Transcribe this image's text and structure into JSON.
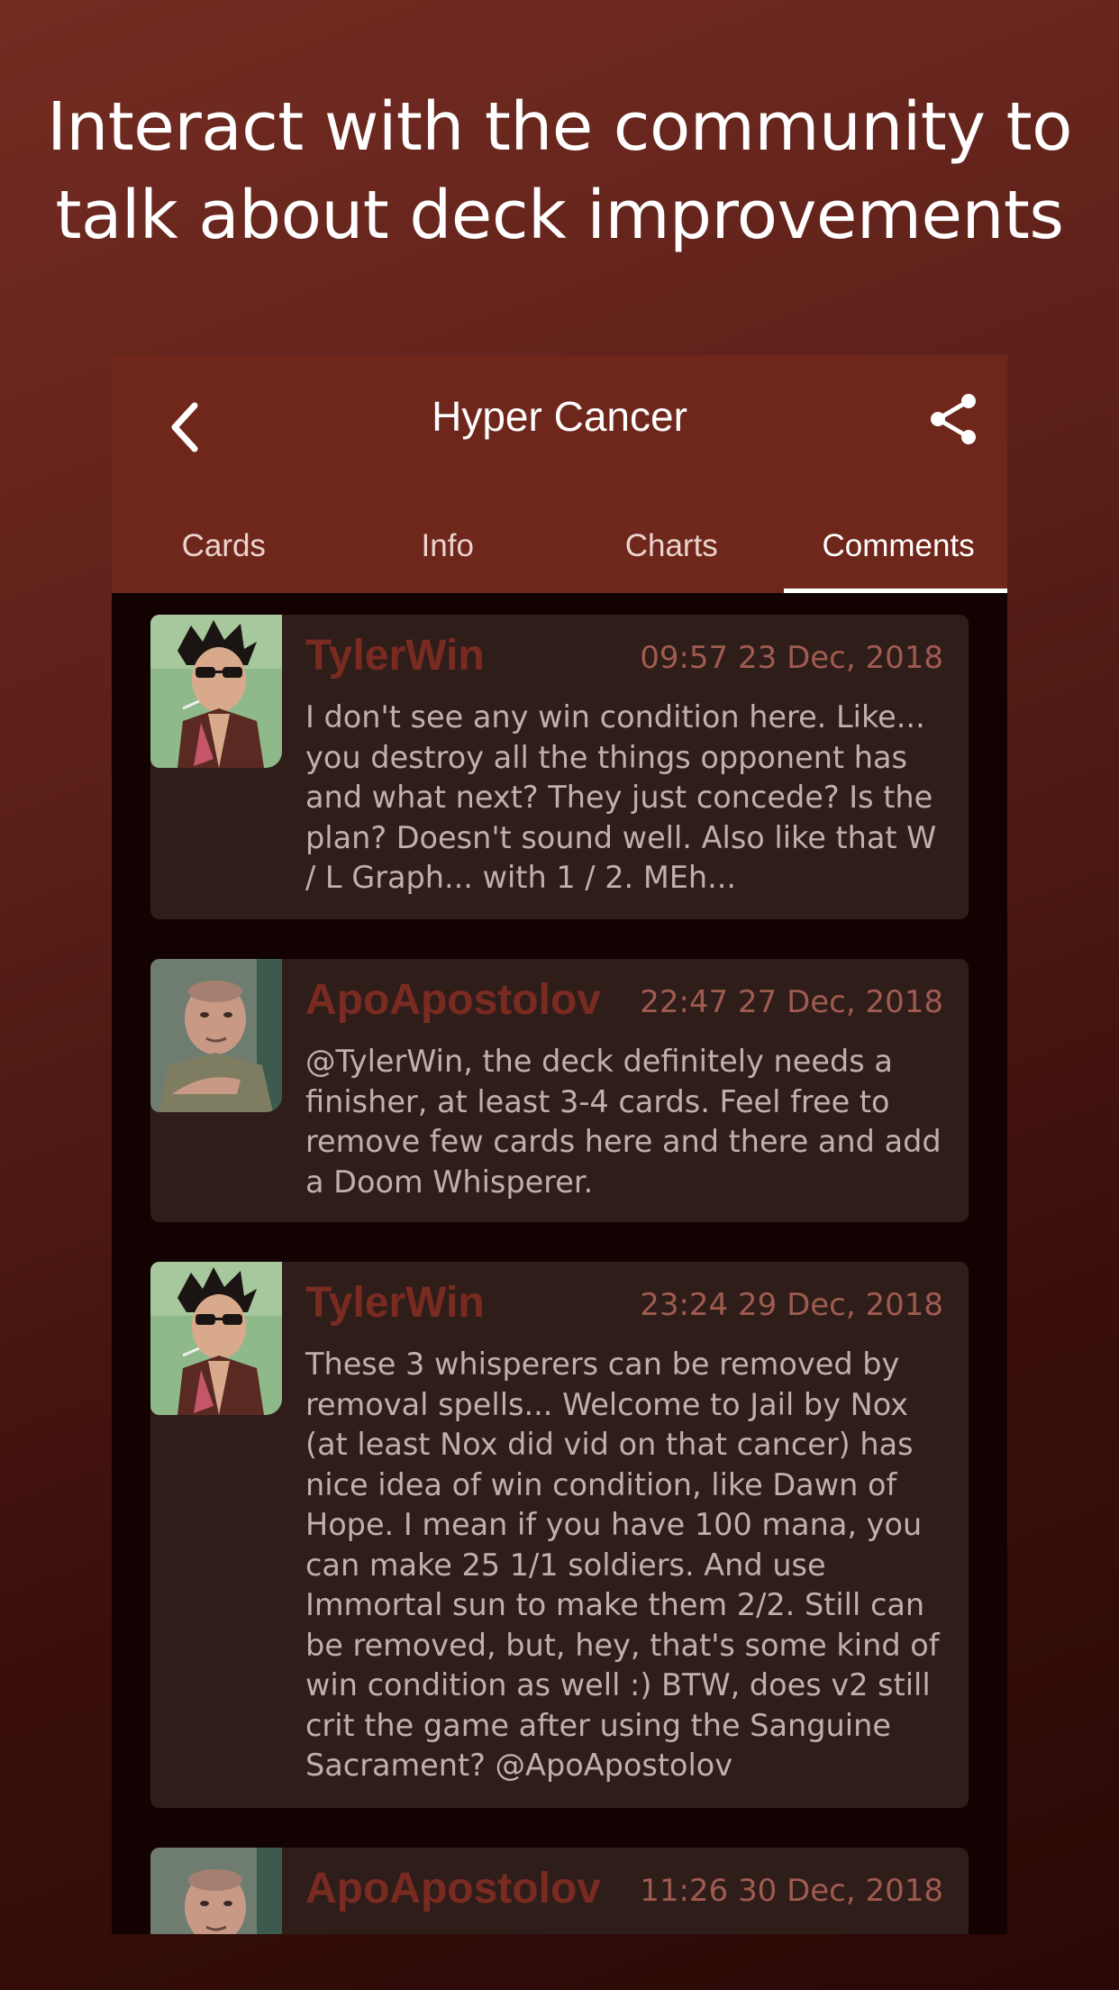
{
  "headline": {
    "line1": "Interact with the community to",
    "line2": "talk about deck improvements"
  },
  "appbar": {
    "title": "Hyper Cancer",
    "back_icon": "chevron-left-icon",
    "share_icon": "share-icon"
  },
  "tabs": [
    {
      "label": "Cards"
    },
    {
      "label": "Info"
    },
    {
      "label": "Charts"
    },
    {
      "label": "Comments",
      "active": true
    }
  ],
  "comments": [
    {
      "author": "TylerWin",
      "date": "09:57 23 Dec, 2018",
      "text": "I don't see any win condition here. Like... you destroy all the things opponent has and what next? They just concede? Is the plan? Doesn't sound well. Also like that W / L Graph... with 1 / 2. MEh..."
    },
    {
      "author": "ApoApostolov",
      "date": "22:47 27 Dec, 2018",
      "text": "@TylerWin, the deck definitely needs a finisher, at least 3-4 cards. Feel free to remove few cards here and there and add a Doom Whisperer."
    },
    {
      "author": "TylerWin",
      "date": "23:24 29 Dec, 2018",
      "text": "These 3 whisperers can be removed by removal spells... Welcome to Jail by Nox (at least Nox did vid on that cancer) has nice idea of win condition, like Dawn of Hope. I mean if you have 100 mana, you can make 25 1/1 soldiers. And use Immortal sun to make them 2/2. Still can be removed, but, hey, that's some kind of win condition as well :) BTW, does v2 still crit the game after using the Sanguine Sacrament? @ApoApostolov"
    },
    {
      "author": "ApoApostolov",
      "date": "11:26 30 Dec, 2018",
      "text": ""
    }
  ],
  "colors": {
    "appbar": "#6f271c",
    "card": "#2f1d1a",
    "author": "#7a2b21",
    "date": "#a05b50"
  }
}
